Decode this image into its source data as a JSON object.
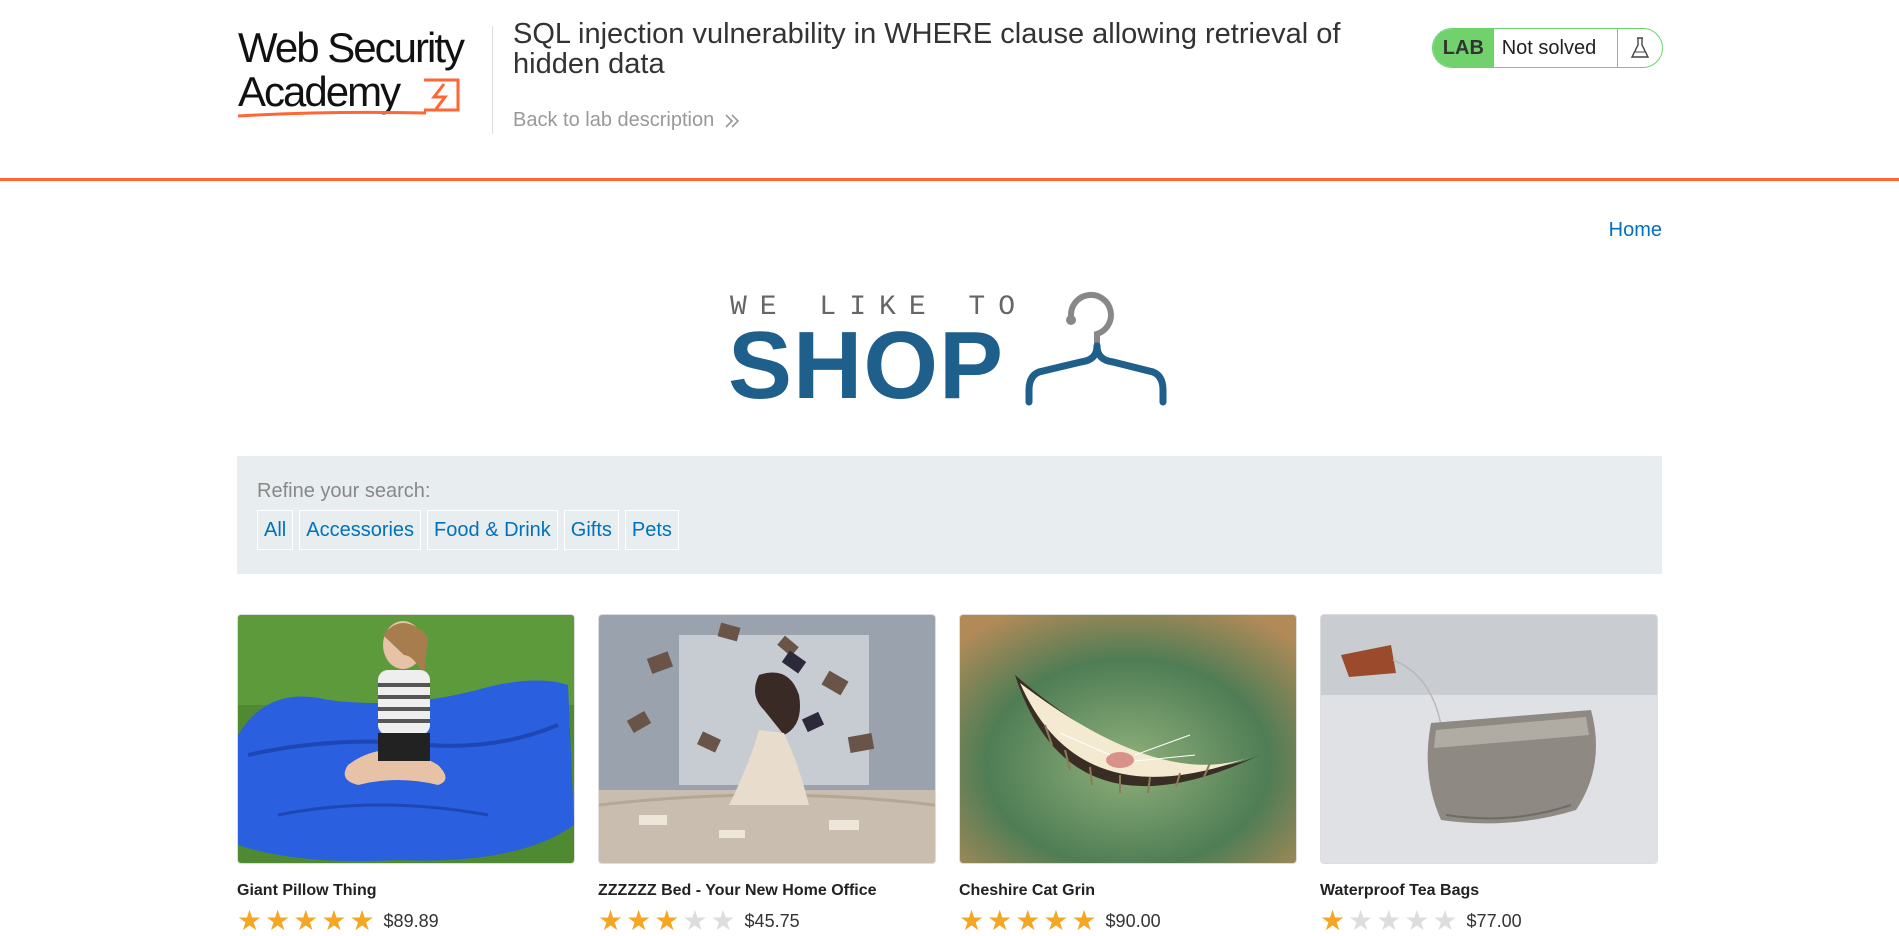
{
  "header": {
    "logo_line1": "Web Security",
    "logo_line2": "Academy",
    "lab_title": "SQL injection vulnerability in WHERE clause allowing retrieval of hidden data",
    "back_link": "Back to lab description",
    "status_tag": "LAB",
    "status_text": "Not solved"
  },
  "nav": {
    "home": "Home"
  },
  "shop_logo": {
    "tagline": "WE LIKE TO",
    "wordmark": "SHOP"
  },
  "filter": {
    "label": "Refine your search:",
    "categories": [
      "All",
      "Accessories",
      "Food & Drink",
      "Gifts",
      "Pets"
    ]
  },
  "products": [
    {
      "name": "Giant Pillow Thing",
      "rating": 5,
      "price": "$89.89"
    },
    {
      "name": "ZZZZZZ Bed - Your New Home Office",
      "rating": 3,
      "price": "$45.75"
    },
    {
      "name": "Cheshire Cat Grin",
      "rating": 5,
      "price": "$90.00"
    },
    {
      "name": "Waterproof Tea Bags",
      "rating": 1,
      "price": "$77.00"
    }
  ],
  "colors": {
    "accent": "#ff6633",
    "link": "#0071bc",
    "lab_green": "#70d16d",
    "shop_blue": "#1f5f8b",
    "star": "#f5a623"
  }
}
